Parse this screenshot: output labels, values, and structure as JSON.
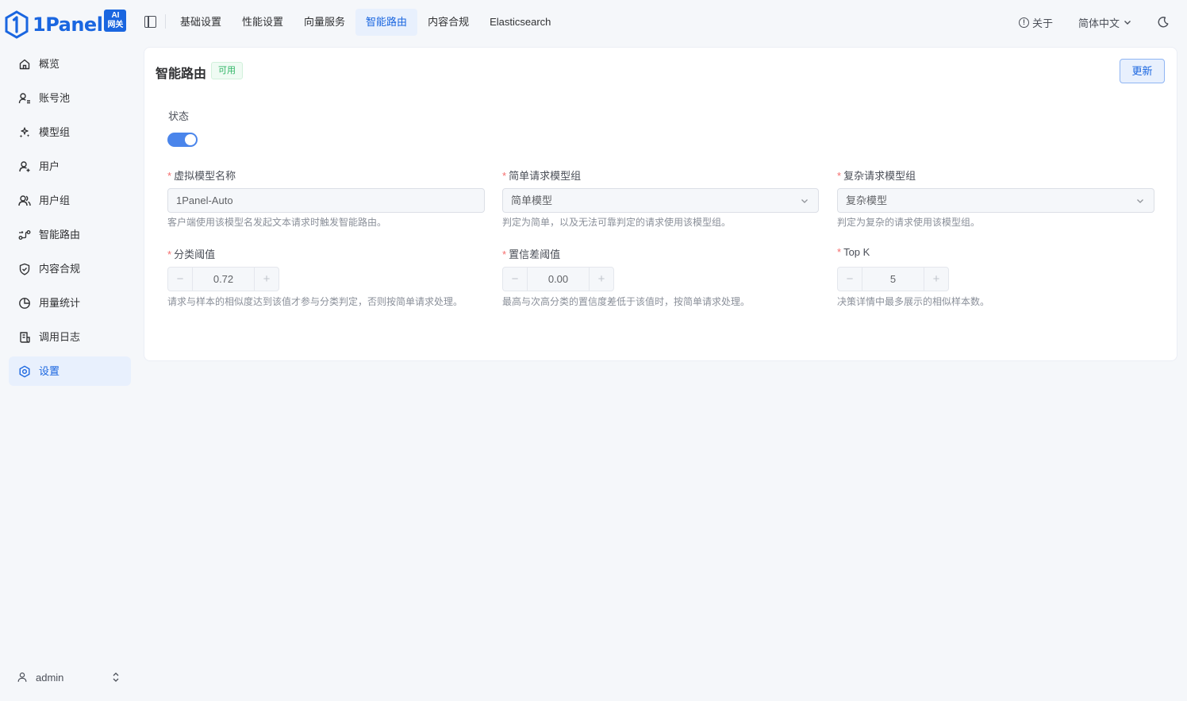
{
  "app": {
    "logo_text": "1Panel",
    "logo_badge_line1": "AI",
    "logo_badge_line2": "网关"
  },
  "tabs": [
    {
      "label": "基础设置",
      "active": false
    },
    {
      "label": "性能设置",
      "active": false
    },
    {
      "label": "向量服务",
      "active": false
    },
    {
      "label": "智能路由",
      "active": true
    },
    {
      "label": "内容合规",
      "active": false
    },
    {
      "label": "Elasticsearch",
      "active": false
    }
  ],
  "header": {
    "about_label": "关于",
    "language_label": "简体中文"
  },
  "sidebar": {
    "items": [
      {
        "label": "概览",
        "icon": "home-icon"
      },
      {
        "label": "账号池",
        "icon": "account-pool-icon"
      },
      {
        "label": "模型组",
        "icon": "model-group-icon"
      },
      {
        "label": "用户",
        "icon": "user-icon"
      },
      {
        "label": "用户组",
        "icon": "user-group-icon"
      },
      {
        "label": "智能路由",
        "icon": "route-icon"
      },
      {
        "label": "内容合规",
        "icon": "shield-icon"
      },
      {
        "label": "用量统计",
        "icon": "pie-chart-icon"
      },
      {
        "label": "调用日志",
        "icon": "log-icon"
      },
      {
        "label": "设置",
        "icon": "gear-icon",
        "active": true
      }
    ],
    "user_label": "admin"
  },
  "card": {
    "title": "智能路由",
    "status_tag": "可用",
    "update_label": "更新",
    "status_label": "状态",
    "status_enabled": true,
    "virtual_model": {
      "label": "虚拟模型名称",
      "value": "1Panel-Auto",
      "help": "客户端使用该模型名发起文本请求时触发智能路由。"
    },
    "simple_group": {
      "label": "简单请求模型组",
      "value": "简单模型",
      "help": "判定为简单，以及无法可靠判定的请求使用该模型组。"
    },
    "complex_group": {
      "label": "复杂请求模型组",
      "value": "复杂模型",
      "help": "判定为复杂的请求使用该模型组。"
    },
    "threshold": {
      "label": "分类阈值",
      "value": "0.72",
      "help": "请求与样本的相似度达到该值才参与分类判定，否则按简单请求处理。"
    },
    "confidence_gap": {
      "label": "置信差阈值",
      "value": "0.00",
      "help": "最高与次高分类的置信度差低于该值时，按简单请求处理。"
    },
    "top_k": {
      "label": "Top K",
      "value": "5",
      "help": "决策详情中最多展示的相似样本数。"
    },
    "stepper_minus": "−",
    "stepper_plus": "+"
  },
  "colors": {
    "primary": "#1a66e0",
    "success": "#2fb566",
    "required": "#f56c6c"
  }
}
